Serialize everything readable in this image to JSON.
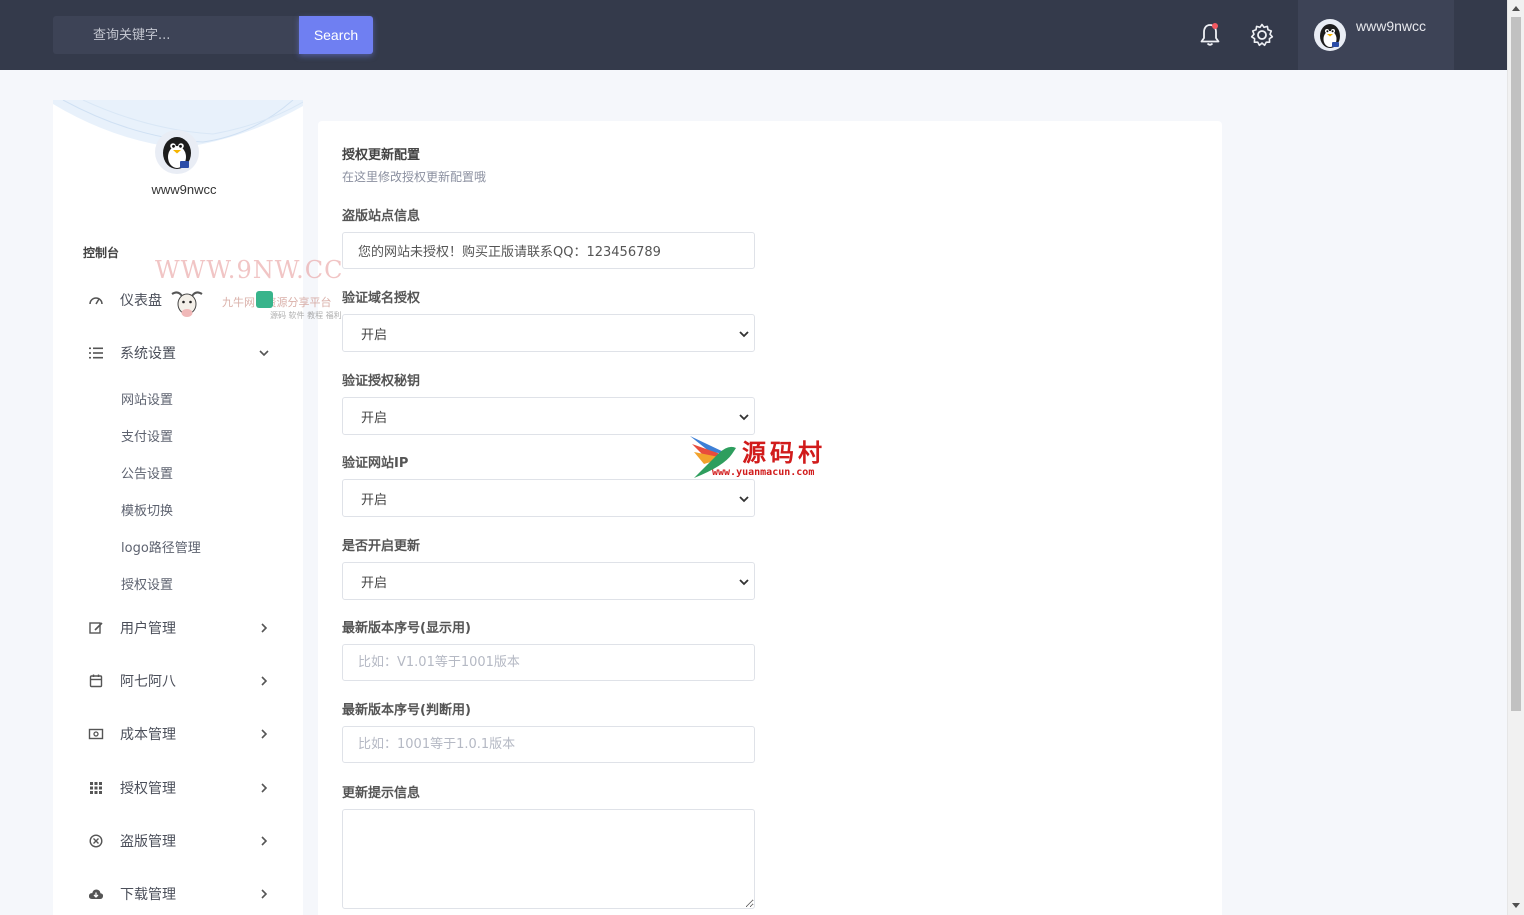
{
  "header": {
    "search_placeholder": "查询关键字...",
    "search_label": "Search",
    "username": "www9nwcc"
  },
  "sidebar": {
    "username": "www9nwcc",
    "section_title": "控制台",
    "items": [
      {
        "label": "仪表盘",
        "icon": "gauge-icon"
      },
      {
        "label": "系统设置",
        "icon": "list-icon",
        "expanded": true
      },
      {
        "label": "用户管理",
        "icon": "edit-icon"
      },
      {
        "label": "阿七阿八",
        "icon": "calendar-icon"
      },
      {
        "label": "成本管理",
        "icon": "money-icon"
      },
      {
        "label": "授权管理",
        "icon": "grid-icon"
      },
      {
        "label": "盗版管理",
        "icon": "close-circle-icon"
      },
      {
        "label": "下载管理",
        "icon": "cloud-download-icon"
      }
    ],
    "sub_items": [
      "网站设置",
      "支付设置",
      "公告设置",
      "模板切换",
      "logo路径管理",
      "授权设置"
    ]
  },
  "form": {
    "title": "授权更新配置",
    "subtitle": "在这里修改授权更新配置哦",
    "piracy_label": "盗版站点信息",
    "piracy_value": "您的网站未授权！购买正版请联系QQ：123456789",
    "domain_label": "验证域名授权",
    "domain_value": "开启",
    "key_label": "验证授权秘钥",
    "key_value": "开启",
    "ip_label": "验证网站IP",
    "ip_value": "开启",
    "update_label": "是否开启更新",
    "update_value": "开启",
    "display_version_label": "最新版本序号(显示用)",
    "display_version_placeholder": "比如：V1.01等于1001版本",
    "judge_version_label": "最新版本序号(判断用)",
    "judge_version_placeholder": "比如：1001等于1.0.1版本",
    "notice_label": "更新提示信息"
  },
  "watermarks": {
    "site": "WWW.9NW.CC",
    "site_name": "九牛网 · 资源分享平台",
    "site_tags": "源码 软件 教程 福利",
    "brand": "源码村",
    "brand_url": "www.yuanmacun.com"
  },
  "colors": {
    "topbar": "#343a4b",
    "accent": "#6f7ff2",
    "background": "#f5f7fb"
  }
}
